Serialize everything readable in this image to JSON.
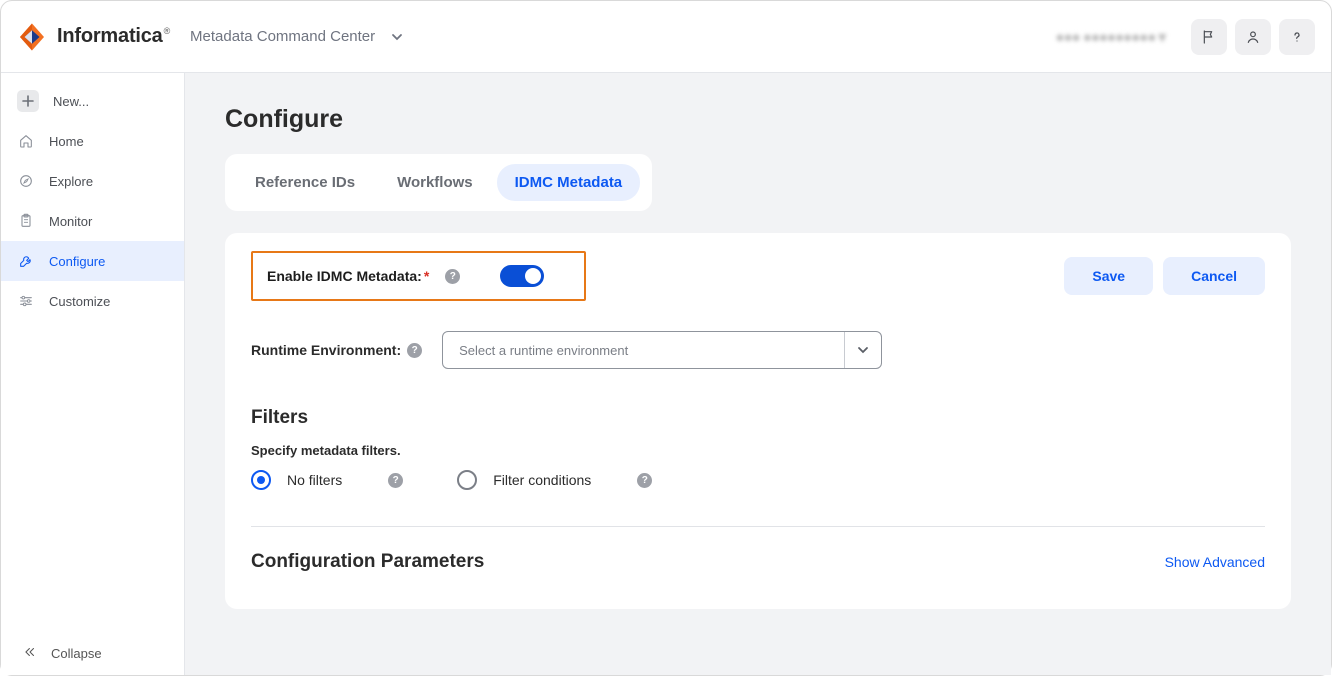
{
  "header": {
    "brand": "Informatica",
    "app": "Metadata Command Center"
  },
  "sidebar": {
    "items": [
      {
        "label": "New..."
      },
      {
        "label": "Home"
      },
      {
        "label": "Explore"
      },
      {
        "label": "Monitor"
      },
      {
        "label": "Configure"
      },
      {
        "label": "Customize"
      }
    ],
    "collapse": "Collapse"
  },
  "page": {
    "title": "Configure",
    "tabs": [
      {
        "label": "Reference IDs"
      },
      {
        "label": "Workflows"
      },
      {
        "label": "IDMC Metadata"
      }
    ],
    "enable_label": "Enable IDMC Metadata:",
    "save": "Save",
    "cancel": "Cancel",
    "runtime_label": "Runtime Environment:",
    "runtime_placeholder": "Select a runtime environment",
    "filters_title": "Filters",
    "filters_sub": "Specify metadata filters.",
    "filter_opts": [
      {
        "label": "No filters"
      },
      {
        "label": "Filter conditions"
      }
    ],
    "config_params": "Configuration Parameters",
    "show_advanced": "Show Advanced"
  }
}
